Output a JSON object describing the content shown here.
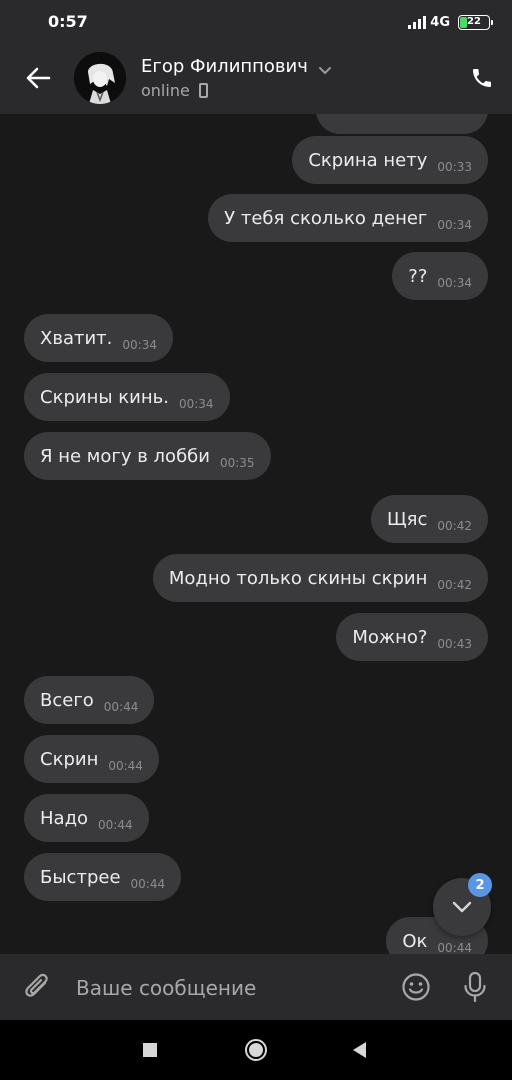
{
  "status_bar": {
    "time": "0:57",
    "network": "4G",
    "battery": "22",
    "battery_level": 0.22
  },
  "header": {
    "contact_name": "Егор Филиппович",
    "contact_status": "online",
    "icons": [
      "back-arrow-icon",
      "chevron-down-icon",
      "mobile-phone-icon",
      "phone-call-icon"
    ]
  },
  "messages": [
    {
      "direction": "out",
      "text": "Скрина нету",
      "time": "00:33"
    },
    {
      "direction": "out",
      "text": "У тебя сколько денег",
      "time": "00:34"
    },
    {
      "direction": "out",
      "text": "??",
      "time": "00:34"
    },
    {
      "direction": "in",
      "text": "Хватит.",
      "time": "00:34"
    },
    {
      "direction": "in",
      "text": "Скрины кинь.",
      "time": "00:34"
    },
    {
      "direction": "in",
      "text": "Я не могу в лобби",
      "time": "00:35"
    },
    {
      "direction": "out",
      "text": "Щяс",
      "time": "00:42"
    },
    {
      "direction": "out",
      "text": "Модно только скины скрин",
      "time": "00:42"
    },
    {
      "direction": "out",
      "text": "Можно?",
      "time": "00:43"
    },
    {
      "direction": "in",
      "text": "Всего",
      "time": "00:44"
    },
    {
      "direction": "in",
      "text": "Скрин",
      "time": "00:44"
    },
    {
      "direction": "in",
      "text": "Надо",
      "time": "00:44"
    },
    {
      "direction": "in",
      "text": "Быстрее",
      "time": "00:44"
    },
    {
      "direction": "out",
      "text": "Ок",
      "time": "00:44"
    }
  ],
  "scroll_down": {
    "unread_count": "2"
  },
  "composer": {
    "placeholder": "Ваше сообщение",
    "icons": [
      "paperclip-icon",
      "emoji-icon",
      "microphone-icon"
    ]
  },
  "navigation": {
    "icons": [
      "recents-square-icon",
      "home-circle-icon",
      "back-triangle-icon"
    ]
  },
  "colors": {
    "background": "#19191a",
    "header": "#2a2a2c",
    "bubble": "#3a3a3c",
    "badge": "#5a96e6"
  }
}
